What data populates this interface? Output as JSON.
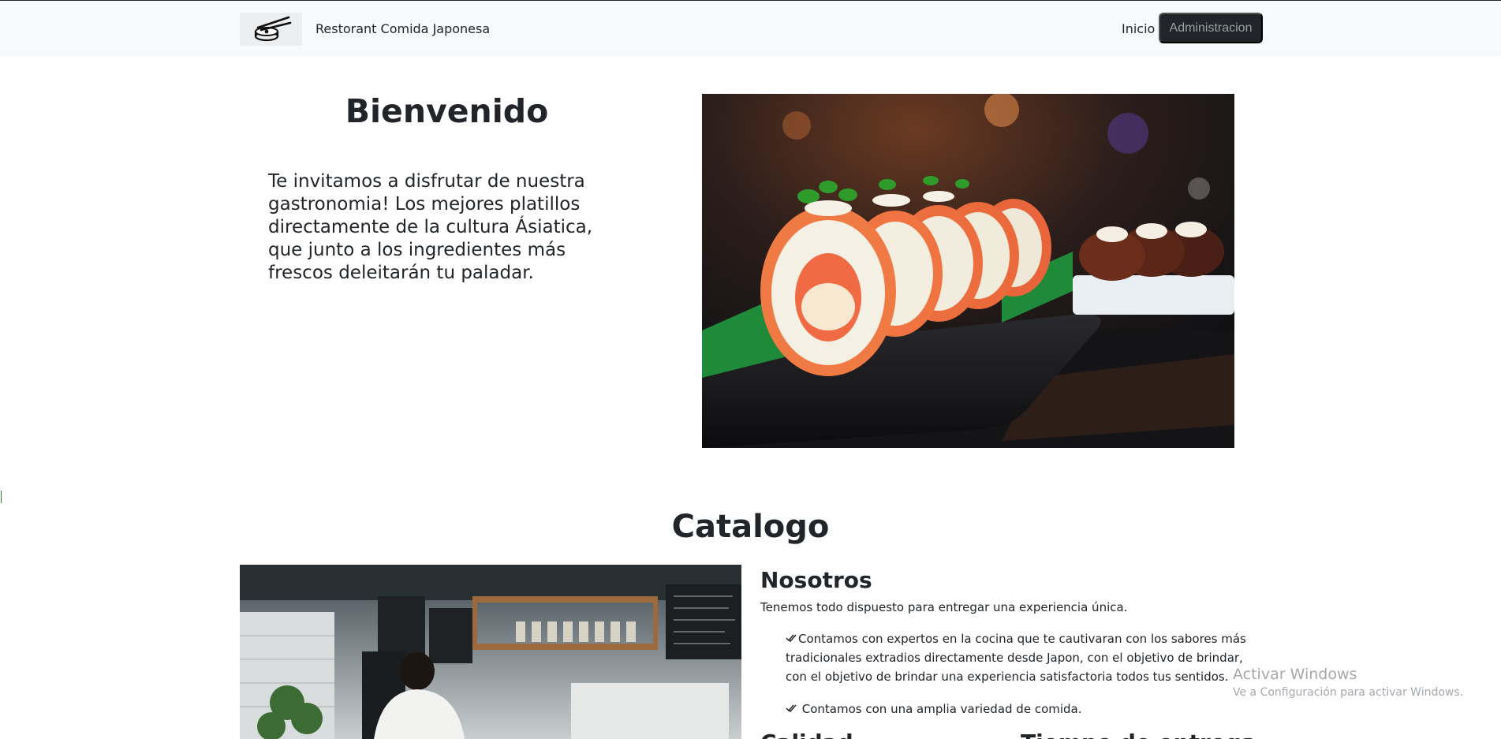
{
  "navbar": {
    "brand_name": "Restorant Comida Japonesa",
    "logo_icon": "chopsticks-sushi-icon",
    "nav_link": "Inicio",
    "admin_button": "Administracion"
  },
  "hero": {
    "title": "Bienvenido",
    "text": "Te invitamos a disfrutar de nuestra gastronomia! Los mejores platillos directamente de la cultura Ásiatica, que junto a los ingredientes más frescos deleitarán tu paladar.",
    "image_icon": "sushi-rolls-photo"
  },
  "catalog": {
    "title": "Catalogo",
    "image_icon": "kitchen-chef-photo",
    "about": {
      "title": "Nosotros",
      "description": "Tenemos todo dispuesto para entregar una experiencia única.",
      "features": [
        "Contamos con expertos en la cocina que te cautivaran con los sabores más tradicionales extradios directamente desde Japon, con el objetivo de brindar, con el objetivo de brindar una experiencia satisfactoria todos tus sentidos.",
        " Contamos con una amplia variedad de comida."
      ],
      "check_icon": "double-check-icon"
    },
    "subheadings": [
      "Calidad",
      "Tiempo de entrega"
    ]
  },
  "windows_watermark": {
    "title": "Activar Windows",
    "subtitle": "Ve a Configuración para activar Windows."
  },
  "colors": {
    "navbar_bg": "#f8f9fa",
    "text": "#212529",
    "button_bg": "#212529",
    "button_text": "#9aa0a6",
    "watermark": "#a4a8ad"
  }
}
